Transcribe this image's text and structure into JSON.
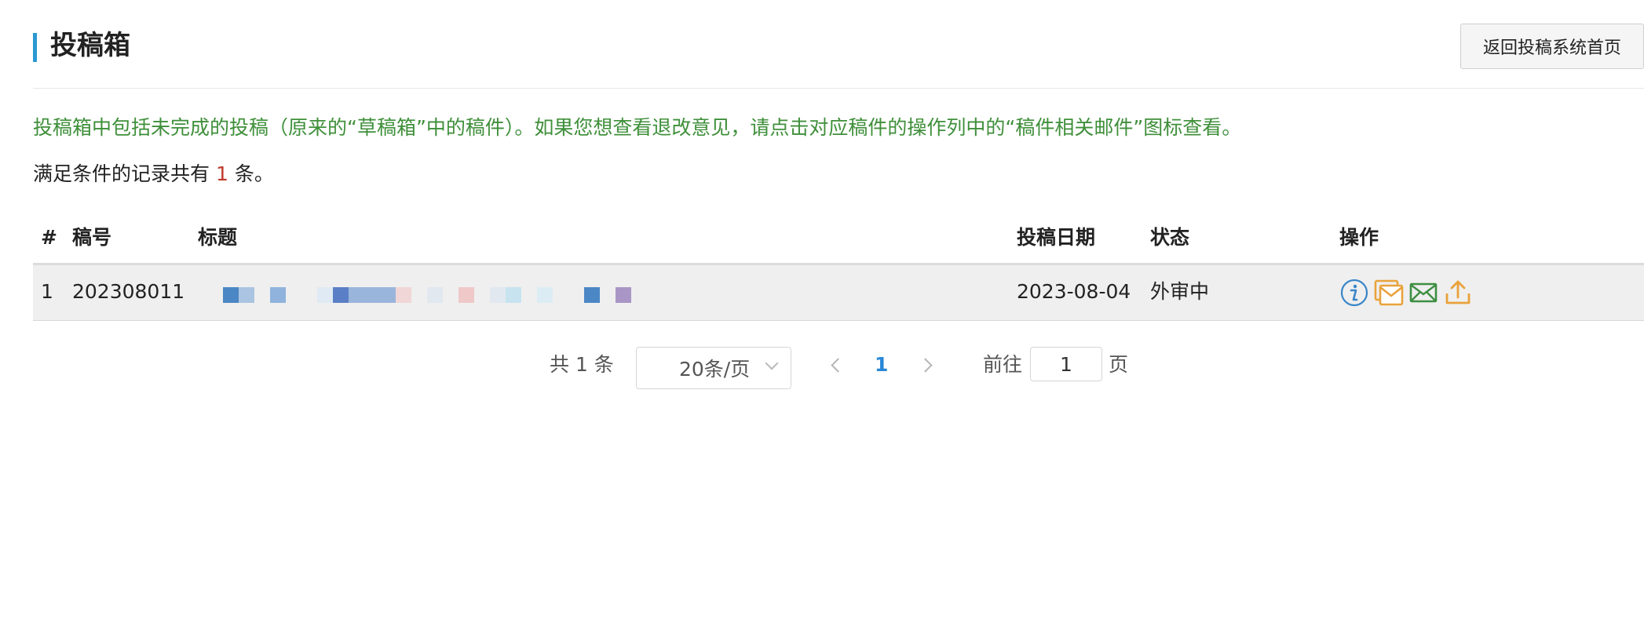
{
  "header": {
    "title": "投稿箱",
    "home_button": "返回投稿系统首页"
  },
  "notice": "投稿箱中包括未完成的投稿（原来的“草稿箱”中的稿件）。如果您想查看退改意见，请点击对应稿件的操作列中的“稿件相关邮件”图标查看。",
  "count": {
    "prefix": "满足条件的记录共有",
    "number": "1",
    "suffix": "条。"
  },
  "table": {
    "headers": [
      "#",
      "稿号",
      "标题",
      "投稿日期",
      "状态",
      "操作"
    ],
    "rows": [
      {
        "index": "1",
        "manuscript_no": "202308011",
        "title": "",
        "date": "2023-08-04",
        "status": "外审中",
        "actions": [
          "info-icon",
          "related-mail-icon",
          "envelope-icon",
          "upload-icon"
        ]
      }
    ]
  },
  "pagination": {
    "total": "共 1 条",
    "page_size": "20条/页",
    "current_page": "1",
    "goto_label": "前往",
    "goto_value": "1",
    "page_label": "页"
  },
  "colors": {
    "accent": "#2a98d3",
    "notice_green": "#3f8f3a",
    "count_red": "#c0392b",
    "link_blue": "#2a87d8",
    "icon_orange": "#e9a23b",
    "icon_green": "#3e8e41"
  }
}
